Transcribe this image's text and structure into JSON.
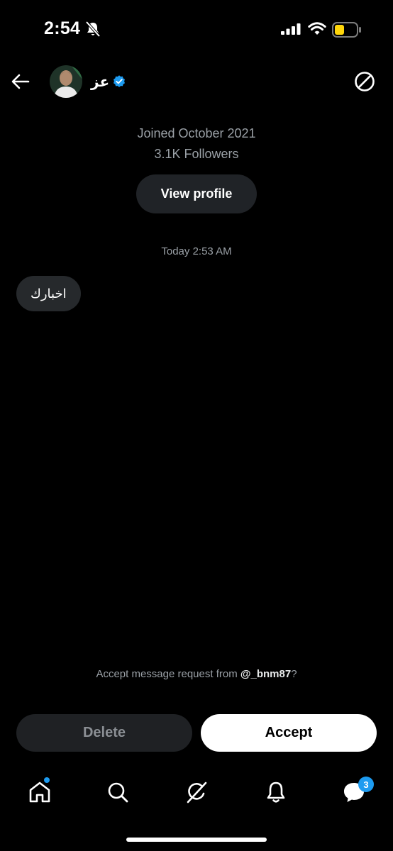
{
  "status_bar": {
    "time": "2:54",
    "icons": [
      "bell-slash-icon",
      "cellular-signal-icon",
      "wifi-icon",
      "battery-icon"
    ],
    "battery_color": "#ffd60a"
  },
  "header": {
    "back_icon": "arrow-left-icon",
    "name": "عز",
    "verified_icon": "verified-badge-icon",
    "block_icon": "block-icon"
  },
  "profile": {
    "joined": "Joined October 2021",
    "followers": "3.1K Followers",
    "view_profile_label": "View profile"
  },
  "conversation": {
    "timestamp": "Today 2:53 AM",
    "messages": [
      {
        "text": "اخبارك",
        "direction": "incoming"
      }
    ]
  },
  "request": {
    "prefix": "Accept message request from ",
    "handle": "@_bnm87",
    "suffix": "?",
    "delete_label": "Delete",
    "accept_label": "Accept"
  },
  "bottom_nav": {
    "items": [
      "home-icon",
      "search-icon",
      "grok-icon",
      "notifications-icon",
      "messages-icon"
    ],
    "messages_badge": "3"
  },
  "colors": {
    "accent": "#1d9bf0",
    "background": "#000000",
    "secondary_text": "#9aa0a6"
  }
}
